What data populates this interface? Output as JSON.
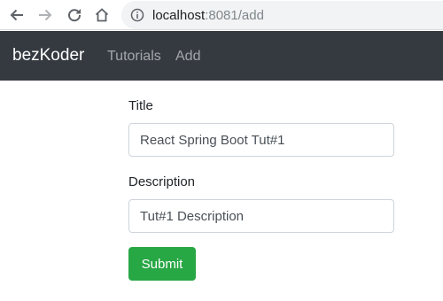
{
  "browser": {
    "address_bar": {
      "host": "localhost",
      "path": ":8081/add"
    },
    "icons": {
      "back": "arrow-left-icon",
      "forward": "arrow-right-icon",
      "reload": "reload-icon",
      "home": "home-icon",
      "site_info": "info-icon"
    }
  },
  "navbar": {
    "brand": "bezKoder",
    "links": [
      "Tutorials",
      "Add"
    ],
    "background": "#343a40"
  },
  "form": {
    "title_label": "Title",
    "title_value": "React Spring Boot Tut#1",
    "description_label": "Description",
    "description_value": "Tut#1 Description",
    "submit_label": "Submit",
    "submit_color": "#28a745"
  }
}
